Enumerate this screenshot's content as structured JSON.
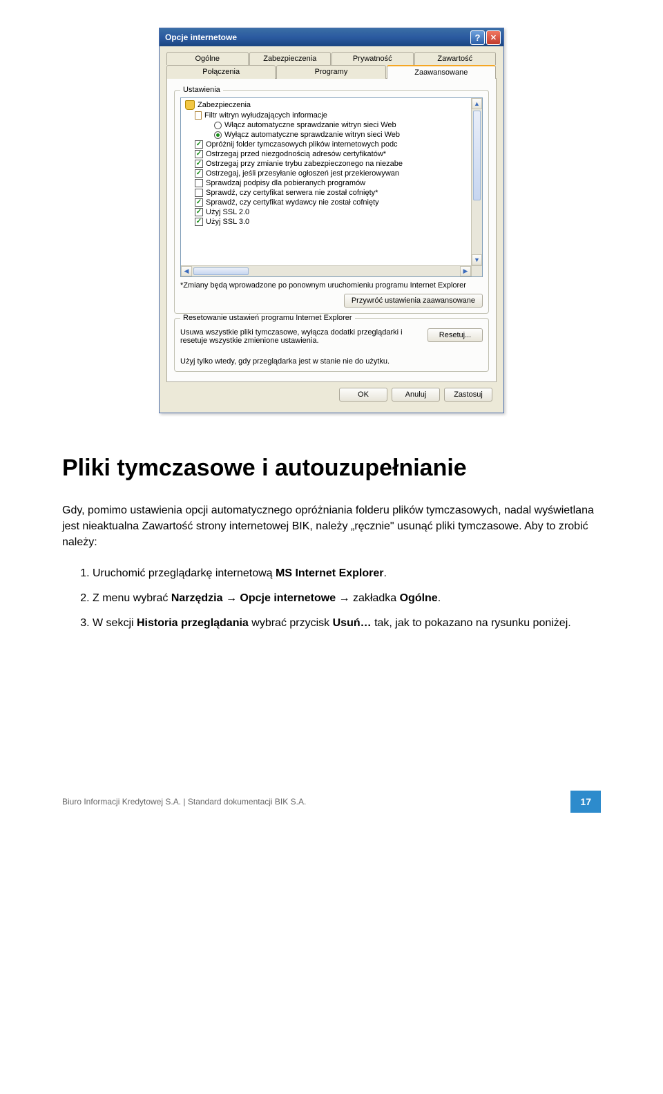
{
  "dialog": {
    "title": "Opcje internetowe",
    "tabs_row1": [
      "Ogólne",
      "Zabezpieczenia",
      "Prywatność",
      "Zawartość"
    ],
    "tabs_row2": [
      "Połączenia",
      "Programy",
      "Zaawansowane"
    ],
    "active_tab": "Zaawansowane",
    "settings_group": "Ustawienia",
    "tree": {
      "security_header": "Zabezpieczenia",
      "phishing_filter": "Filtr witryn wyłudzających informacje",
      "items": [
        {
          "type": "radio",
          "checked": false,
          "label": "Włącz automatyczne sprawdzanie witryn sieci Web"
        },
        {
          "type": "radio",
          "checked": true,
          "label": "Wyłącz automatyczne sprawdzanie witryn sieci Web"
        },
        {
          "type": "check",
          "checked": true,
          "label": "Opróżnij folder tymczasowych plików internetowych podc"
        },
        {
          "type": "check",
          "checked": true,
          "label": "Ostrzegaj przed niezgodnością adresów certyfikatów*"
        },
        {
          "type": "check",
          "checked": true,
          "label": "Ostrzegaj przy zmianie trybu zabezpieczonego na niezabe"
        },
        {
          "type": "check",
          "checked": true,
          "label": "Ostrzegaj, jeśli przesyłanie ogłoszeń jest przekierowywan"
        },
        {
          "type": "check",
          "checked": false,
          "label": "Sprawdzaj podpisy dla pobieranych programów"
        },
        {
          "type": "check",
          "checked": false,
          "label": "Sprawdź, czy certyfikat serwera nie został cofnięty*"
        },
        {
          "type": "check",
          "checked": true,
          "label": "Sprawdź, czy certyfikat wydawcy nie został cofnięty"
        },
        {
          "type": "check",
          "checked": true,
          "label": "Użyj SSL 2.0"
        },
        {
          "type": "check",
          "checked": true,
          "label": "Użyj SSL 3.0"
        }
      ]
    },
    "note": "*Zmiany będą wprowadzone po ponownym uruchomieniu programu Internet Explorer",
    "restore_btn": "Przywróć ustawienia zaawansowane",
    "reset_group": "Resetowanie ustawień programu Internet Explorer",
    "reset_text": "Usuwa wszystkie pliki tymczasowe, wyłącza dodatki przeglądarki i resetuje wszystkie zmienione ustawienia.",
    "reset_btn": "Resetuj...",
    "warn": "Użyj tylko wtedy, gdy przeglądarka jest w stanie nie do użytku.",
    "ok": "OK",
    "cancel": "Anuluj",
    "apply": "Zastosuj"
  },
  "doc": {
    "heading": "Pliki tymczasowe i autouzupełnianie",
    "para_parts": {
      "p1": "Gdy, pomimo ustawienia opcji automatycznego opróżniania folderu plików tymczasowych, nadal wyświetlana jest nieaktualna Zawartość strony internetowej BIK, należy „ręcznie\" usunąć pliki tymczasowe. Aby to zrobić należy:"
    },
    "list": {
      "i1_pre": "Uruchomić przeglądarkę internetową ",
      "i1_bold": "MS Internet Explorer",
      "i1_post": ".",
      "i2_pre": "Z menu wybrać ",
      "i2_b1": "Narzędzia",
      "i2_arr1": " → ",
      "i2_b2": "Opcje internetowe",
      "i2_arr2": " → zakładka ",
      "i2_b3": "Ogólne",
      "i2_post": ".",
      "i3_pre": "W sekcji ",
      "i3_b1": "Historia przeglądania",
      "i3_mid": " wybrać przycisk ",
      "i3_b2": "Usuń…",
      "i3_post": " tak, jak to pokazano na rysunku poniżej."
    }
  },
  "footer": {
    "left": "Biuro Informacji Kredytowej S.A. | Standard dokumentacji BIK S.A.",
    "page": "17"
  }
}
